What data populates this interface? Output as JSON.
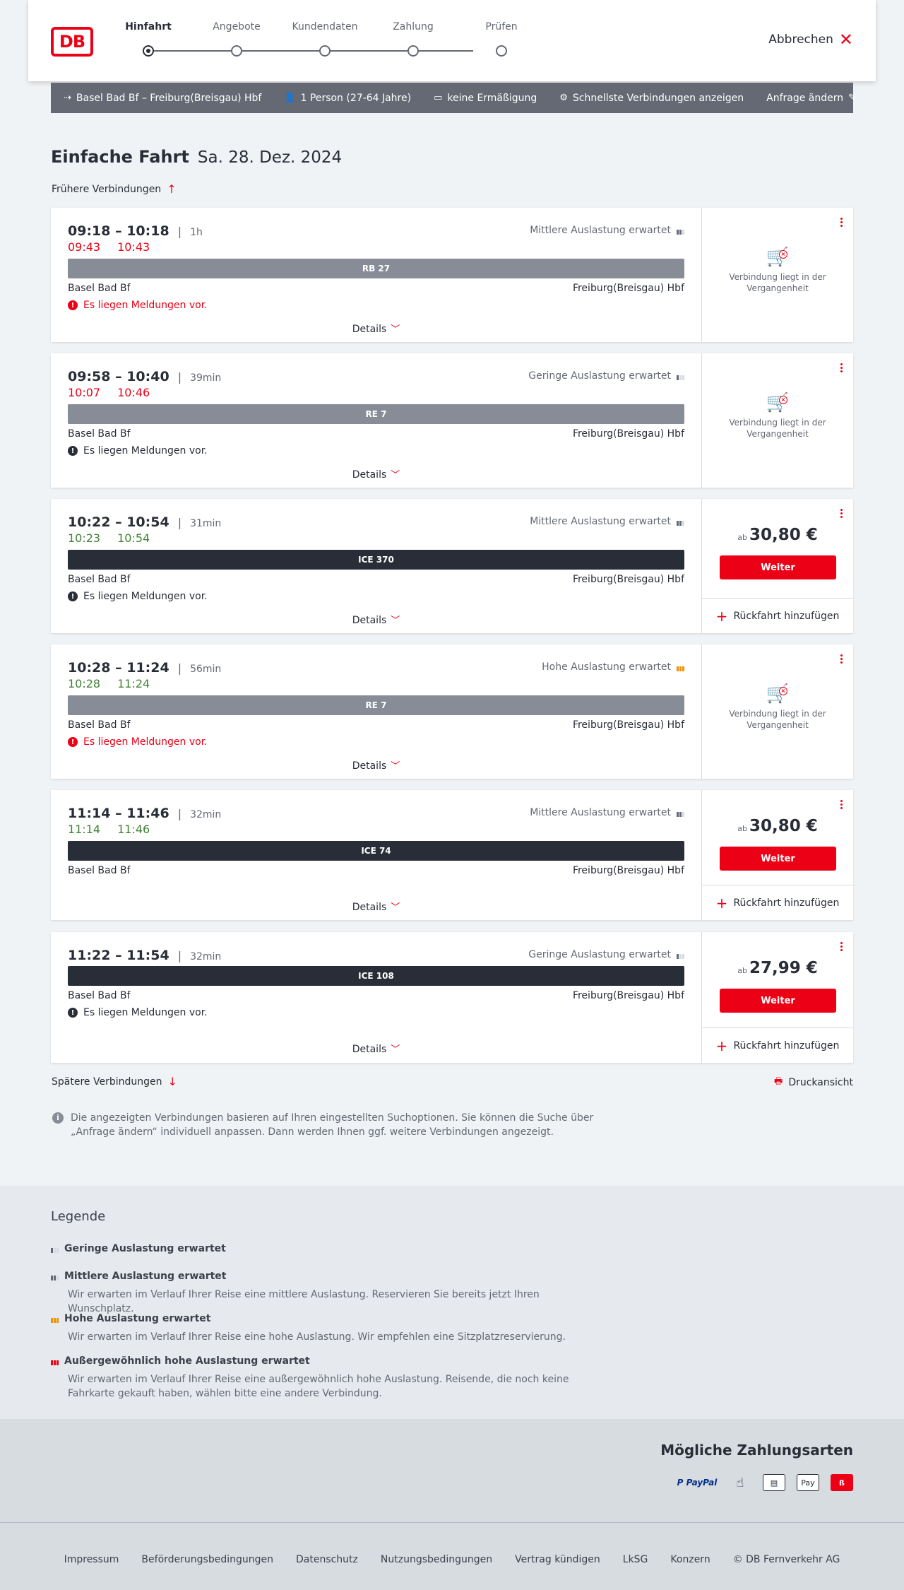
{
  "header": {
    "logo": "DB",
    "steps": [
      "Hinfahrt",
      "Angebote",
      "Kundendaten",
      "Zahlung",
      "Prüfen"
    ],
    "cancel_label": "Abbrechen"
  },
  "query": {
    "route": "Basel Bad Bf – Freiburg(Breisgau) Hbf",
    "passengers": "1 Person (27-64 Jahre)",
    "discount": "keine Ermäßigung",
    "fastest": "Schnellste Verbindungen anzeigen",
    "edit": "Anfrage ändern"
  },
  "title": {
    "main": "Einfache Fahrt",
    "date": "Sa. 28. Dez. 2024"
  },
  "earlier_label": "Frühere Verbindungen",
  "later_label": "Spätere Verbindungen",
  "print_label": "Druckansicht",
  "common": {
    "details": "Details",
    "from": "Basel Bad Bf",
    "to": "Freiburg(Breisgau) Hbf",
    "price_prefix": "ab",
    "continue": "Weiter",
    "return_label": "Rückfahrt hinzufügen",
    "past_text": "Verbindung liegt in der Vergangenheit"
  },
  "connections": [
    {
      "times": "09:18 – 10:18",
      "duration": "1h",
      "rt_dep": "09:43",
      "rt_arr": "10:43",
      "rt_status": "late",
      "occupancy": "Mittlere Auslastung erwartet",
      "occ_level": 2,
      "train": "RB 27",
      "train_type": "regio",
      "message": "Es liegen Meldungen vor.",
      "message_type": "warn",
      "price": null
    },
    {
      "times": "09:58 – 10:40",
      "duration": "39min",
      "rt_dep": "10:07",
      "rt_arr": "10:46",
      "rt_status": "late",
      "occupancy": "Geringe Auslastung erwartet",
      "occ_level": 1,
      "train": "RE 7",
      "train_type": "regio",
      "message": "Es liegen Meldungen vor.",
      "message_type": "info",
      "price": null
    },
    {
      "times": "10:22 – 10:54",
      "duration": "31min",
      "rt_dep": "10:23",
      "rt_arr": "10:54",
      "rt_status": "ok",
      "occupancy": "Mittlere Auslastung erwartet",
      "occ_level": 2,
      "train": "ICE 370",
      "train_type": "fern",
      "message": "Es liegen Meldungen vor.",
      "message_type": "info",
      "price": "30,80 €"
    },
    {
      "times": "10:28 – 11:24",
      "duration": "56min",
      "rt_dep": "10:28",
      "rt_arr": "11:24",
      "rt_status": "ok",
      "occupancy": "Hohe Auslastung erwartet",
      "occ_level": 3,
      "train": "RE 7",
      "train_type": "regio",
      "message": "Es liegen Meldungen vor.",
      "message_type": "warn",
      "price": null
    },
    {
      "times": "11:14 – 11:46",
      "duration": "32min",
      "rt_dep": "11:14",
      "rt_arr": "11:46",
      "rt_status": "ok",
      "occupancy": "Mittlere Auslastung erwartet",
      "occ_level": 2,
      "train": "ICE 74",
      "train_type": "fern",
      "message": null,
      "message_type": null,
      "price": "30,80 €"
    },
    {
      "times": "11:22 – 11:54",
      "duration": "32min",
      "rt_dep": null,
      "rt_arr": null,
      "rt_status": null,
      "occupancy": "Geringe Auslastung erwartet",
      "occ_level": 1,
      "train": "ICE 108",
      "train_type": "fern",
      "message": "Es liegen Meldungen vor.",
      "message_type": "info",
      "price": "27,99 €"
    }
  ],
  "note": "Die angezeigten Verbindungen basieren auf Ihren eingestellten Suchoptionen. Sie können die Suche über „Anfrage ändern“ individuell anpassen. Dann werden Ihnen ggf. weitere Verbindungen angezeigt.",
  "legend": {
    "title": "Legende",
    "items": [
      {
        "title": "Geringe Auslastung erwartet",
        "desc": ""
      },
      {
        "title": "Mittlere Auslastung erwartet",
        "desc": "Wir erwarten im Verlauf Ihrer Reise eine mittlere Auslastung. Reservieren Sie bereits jetzt Ihren Wunschplatz."
      },
      {
        "title": "Hohe Auslastung erwartet",
        "desc": "Wir erwarten im Verlauf Ihrer Reise eine hohe Auslastung. Wir empfehlen eine Sitzplatzreservierung."
      },
      {
        "title": "Außergewöhnlich hohe Auslastung erwartet",
        "desc": "Wir erwarten im Verlauf Ihrer Reise eine außergewöhnlich hohe Auslastung. Reisende, die noch keine Fahrkarte gekauft haben, wählen bitte eine andere Verbindung."
      }
    ]
  },
  "payment": {
    "title": "Mögliche Zahlungsarten",
    "methods": [
      "PayPal",
      "Kreditkarte",
      "SEPA Lastschrift",
      "Apple Pay",
      "DB Rechnung"
    ]
  },
  "payment_labels": {
    "paypal": "P PayPal",
    "applepay": "Pay"
  },
  "footer": {
    "links": [
      "Impressum",
      "Beförderungsbedingungen",
      "Datenschutz",
      "Nutzungsbedingungen",
      "Vertrag kündigen",
      "LkSG",
      "Konzern",
      "© DB Fernverkehr AG"
    ]
  },
  "colors": {
    "accent": "#ec0016",
    "late": "#ec0016",
    "on_time": "#408335",
    "high_occupancy": "#f39200"
  }
}
